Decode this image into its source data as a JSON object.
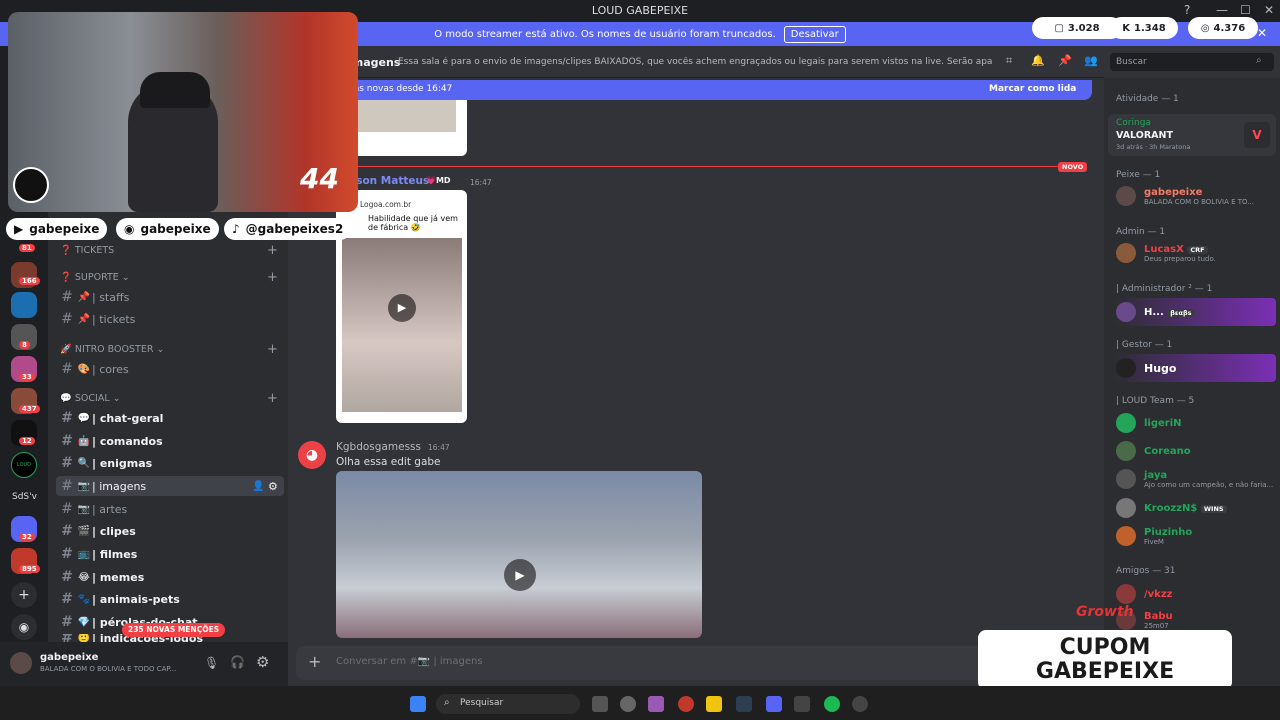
{
  "window": {
    "title": "LOUD GABEPEIXE"
  },
  "banner": {
    "text": "O modo streamer está ativo. Os nomes de usuário foram truncados.",
    "button": "Desativar"
  },
  "stats": [
    {
      "icon": "chat-bubble-icon",
      "value": "3.028"
    },
    {
      "icon": "kick-logo-icon",
      "value": "1.348"
    },
    {
      "icon": "globe-icon",
      "value": "4.376"
    }
  ],
  "server_badges": [
    "81",
    "166",
    "8",
    "33",
    "437",
    "12",
    "32",
    "895"
  ],
  "server_labels": {
    "loud": "LOUD",
    "sds": "SdS'v"
  },
  "socials": [
    {
      "icon": "youtube-icon",
      "handle": "gabepeixe"
    },
    {
      "icon": "instagram-icon",
      "handle": "gabepeixe"
    },
    {
      "icon": "tiktok-icon",
      "handle": "@gabepeixes2"
    }
  ],
  "cam": {
    "number": "44"
  },
  "channels": {
    "categories": {
      "tickets": "TICKETS",
      "suporte": "SUPORTE",
      "nitro": "NITRO BOOSTER",
      "social": "SOCIAL"
    },
    "items": [
      {
        "emoji": "📌",
        "label": "| staffs"
      },
      {
        "emoji": "📌",
        "label": "| tickets"
      },
      {
        "emoji": "🎨",
        "label": "| cores"
      },
      {
        "emoji": "💬",
        "label": "| chat-geral"
      },
      {
        "emoji": "🤖",
        "label": "| comandos"
      },
      {
        "emoji": "🔍",
        "label": "| enigmas"
      },
      {
        "emoji": "📷",
        "label": "| imagens"
      },
      {
        "emoji": "📷",
        "label": "| artes"
      },
      {
        "emoji": "🎬",
        "label": "| clipes"
      },
      {
        "emoji": "📺",
        "label": "| filmes"
      },
      {
        "emoji": "😂",
        "label": "| memes"
      },
      {
        "emoji": "🐾",
        "label": "| animais-pets"
      },
      {
        "emoji": "💎",
        "label": "| pérolas-do-chat"
      },
      {
        "emoji": "🙂",
        "label": "| indicações-jogos"
      }
    ],
    "mentions_pill": "235 NOVAS MENÇÕES"
  },
  "user": {
    "name": "gabepeixe",
    "status": "BALADA COM O BOLIVIA E TODO CAP..."
  },
  "chat": {
    "channel_name": "imagens",
    "topic": "Essa sala é para o envio de imagens/clipes BAIXADOS, que vocês achem engraçados ou legais para serem vistos na live. Serão apagados prints de o...",
    "search_placeholder": "Buscar",
    "new_since": "ens novas desde 16:47",
    "mark_read": "Marcar como lida",
    "new_label": "NOVO",
    "msg1": {
      "author": "Jerson Matteus",
      "tag": "MD",
      "time": "16:47",
      "site": "Logoa.com.br",
      "caption": "Habilidade que já vem de fábrica 🤣"
    },
    "msg2": {
      "author": "Kgbdosgamesss",
      "time": "16:47",
      "text": "Olha essa edit gabe"
    },
    "composer_placeholder": "Conversar em #📷 | imagens"
  },
  "members": {
    "activity": {
      "header": "Atividade — 1",
      "name": "Coringa",
      "game": "VALORANT",
      "meta": "3d atrás · 3h Maratona"
    },
    "groups": [
      {
        "header": "Peixe — 1",
        "members": [
          {
            "name": "gabepeixe",
            "sub": "BALADA COM O BOLIVIA E TO...",
            "color": "#f47b67"
          }
        ]
      },
      {
        "header": "Admin — 1",
        "members": [
          {
            "name": "LucasX",
            "badge": "CRF",
            "sub": "Deus preparou tudo.",
            "color": "#f23f43"
          }
        ]
      },
      {
        "header": "| Administrador ² — 1",
        "members": [
          {
            "name": "H...",
            "badge": "βεαβs",
            "sub": "",
            "color": "#ffffff"
          }
        ]
      },
      {
        "header": "| Gestor — 1",
        "members": [
          {
            "name": "Hugo",
            "sub": "",
            "color": "#ffffff"
          }
        ]
      },
      {
        "header": "| LOUD Team — 5",
        "members": [
          {
            "name": "ligeriN",
            "sub": "",
            "color": "#23a55a"
          },
          {
            "name": "Coreano",
            "sub": "",
            "color": "#23a55a"
          },
          {
            "name": "jaya",
            "sub": "Ajo como um campeão, e não faria...",
            "color": "#23a55a"
          },
          {
            "name": "KroozzN$",
            "badge": "WINS",
            "sub": "",
            "color": "#23a55a"
          },
          {
            "name": "Piuzinho",
            "sub": "FiveM",
            "color": "#23a55a"
          }
        ]
      },
      {
        "header": "Amigos — 31",
        "members": [
          {
            "name": "/vkzz",
            "sub": "",
            "color": "#f23f43"
          },
          {
            "name": "Babu",
            "sub": "25m07",
            "color": "#f23f43"
          }
        ]
      }
    ]
  },
  "cupom": {
    "line1": "CUPOM",
    "line2": "GABEPEIXE",
    "brand": "Growth"
  },
  "taskbar": {
    "search": "Pesquisar"
  }
}
